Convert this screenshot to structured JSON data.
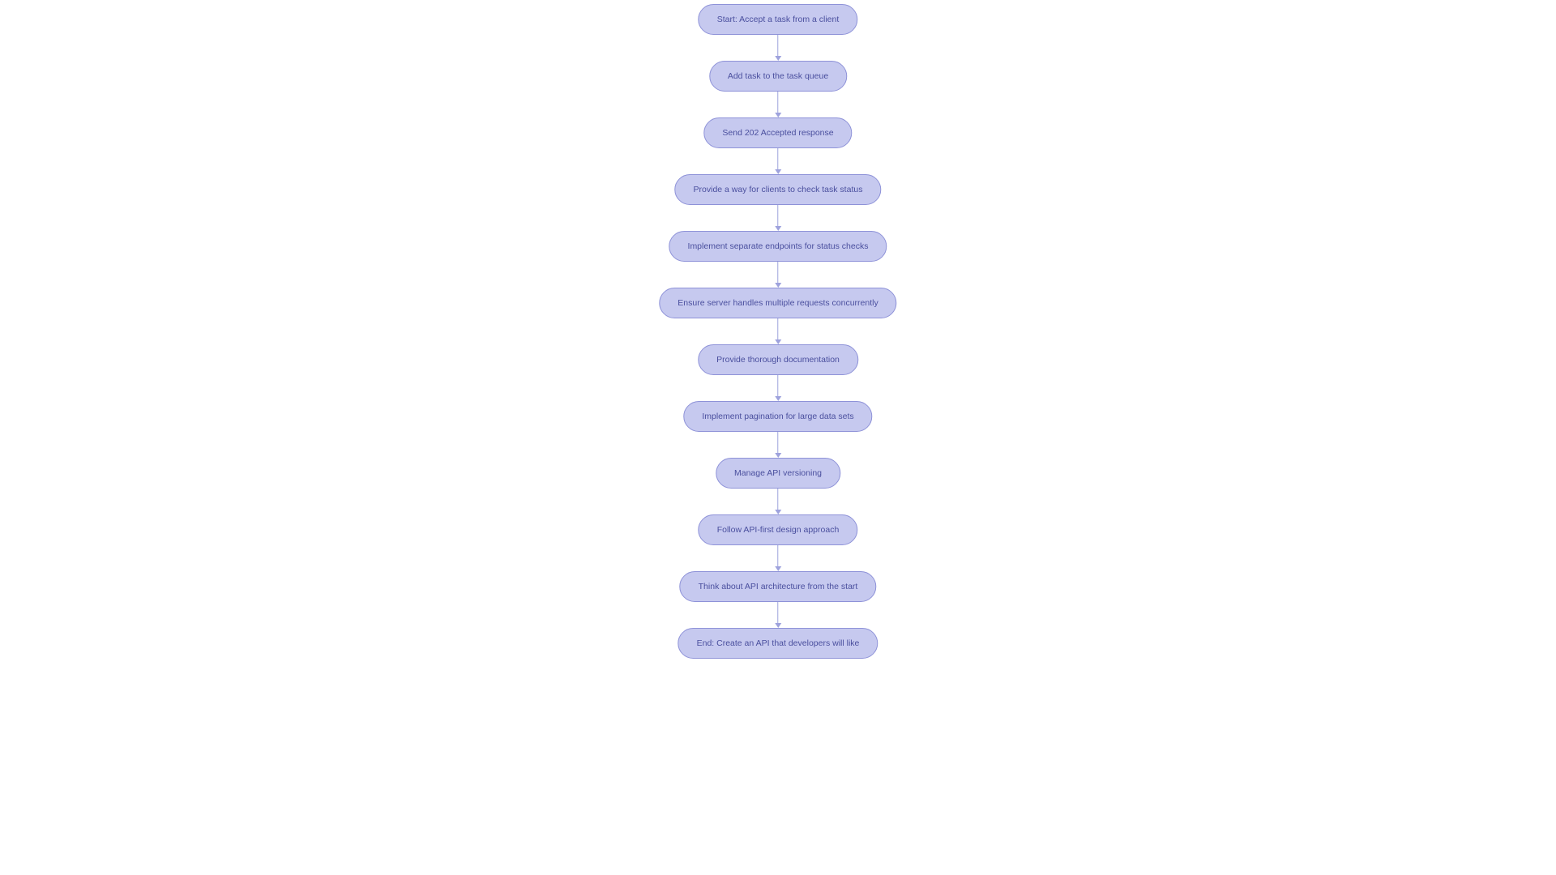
{
  "flow": {
    "nodes": [
      {
        "label": "Start: Accept a task from a client"
      },
      {
        "label": "Add task to the task queue"
      },
      {
        "label": "Send 202 Accepted response"
      },
      {
        "label": "Provide a way for clients to check task status"
      },
      {
        "label": "Implement separate endpoints for status checks"
      },
      {
        "label": "Ensure server handles multiple requests concurrently"
      },
      {
        "label": "Provide thorough documentation"
      },
      {
        "label": "Implement pagination for large data sets"
      },
      {
        "label": "Manage API versioning"
      },
      {
        "label": "Follow API-first design approach"
      },
      {
        "label": "Think about API architecture from the start"
      },
      {
        "label": "End: Create an API that developers will like"
      }
    ]
  },
  "colors": {
    "node_fill": "#c6c9ef",
    "node_border": "#8e92d8",
    "text": "#4a4f9e",
    "arrow": "#9ea2dd"
  }
}
